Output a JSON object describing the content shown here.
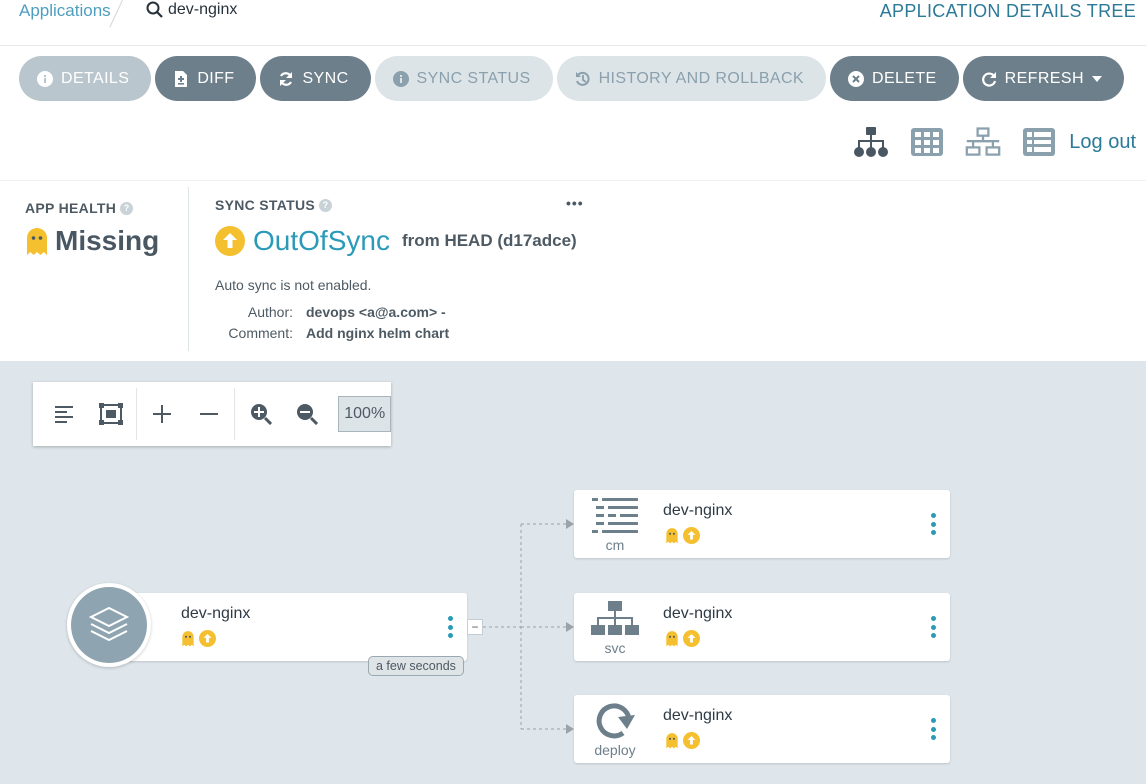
{
  "breadcrumb": {
    "applications": "Applications",
    "current": "dev-nginx"
  },
  "page_title": "APPLICATION DETAILS TREE",
  "actions": [
    {
      "label": "DETAILS",
      "icon": "info-icon"
    },
    {
      "label": "DIFF",
      "icon": "file-diff-icon"
    },
    {
      "label": "SYNC",
      "icon": "sync-icon"
    },
    {
      "label": "SYNC STATUS",
      "icon": "info-icon"
    },
    {
      "label": "HISTORY AND ROLLBACK",
      "icon": "history-icon"
    },
    {
      "label": "DELETE",
      "icon": "times-circle-icon"
    },
    {
      "label": "REFRESH",
      "icon": "refresh-icon"
    }
  ],
  "logout": "Log out",
  "app_health": {
    "label": "APP HEALTH",
    "value": "Missing"
  },
  "sync_status": {
    "label": "SYNC STATUS",
    "more": "•••",
    "value": "OutOfSync",
    "from": "from HEAD (d17adce)",
    "auto_sync": "Auto sync is not enabled.",
    "author_key": "Author:",
    "author_val": "devops <a@a.com> -",
    "comment_key": "Comment:",
    "comment_val": "Add nginx helm chart"
  },
  "toolbar": {
    "zoom": "100%"
  },
  "colors": {
    "accent": "#2a9ab8",
    "missing": "#f4c030",
    "outofsync": "#f4c030",
    "button": "#6d7f8b"
  },
  "graph": {
    "app_node": {
      "name": "dev-nginx",
      "age": "a few seconds"
    },
    "resources": [
      {
        "name": "dev-nginx",
        "kind": "cm",
        "icon": "configmap-icon"
      },
      {
        "name": "dev-nginx",
        "kind": "svc",
        "icon": "service-icon"
      },
      {
        "name": "dev-nginx",
        "kind": "deploy",
        "icon": "deployment-icon"
      }
    ]
  }
}
